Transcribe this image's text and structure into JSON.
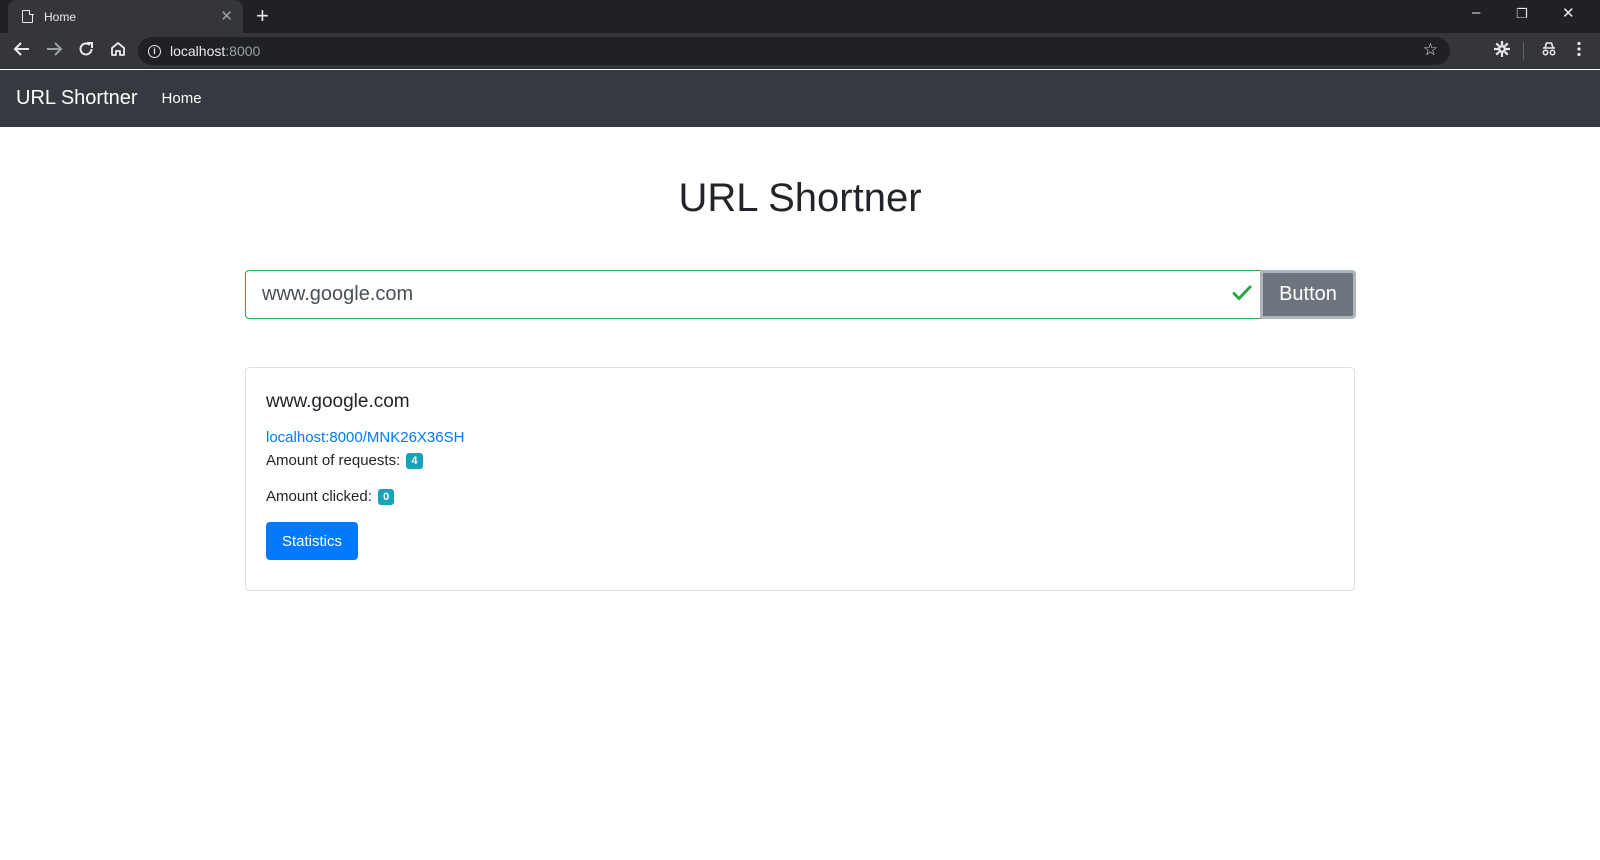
{
  "browser": {
    "tab_title": "Home",
    "tab_close": "✕",
    "new_tab": "+",
    "url_host": "localhost",
    "url_port": ":8000",
    "controls": {
      "minimize": "–",
      "restore": "❐",
      "close": "✕"
    }
  },
  "navbar": {
    "brand": "URL Shortner",
    "links": [
      {
        "label": "Home"
      }
    ]
  },
  "main": {
    "title": "URL Shortner",
    "input_value": "www.google.com",
    "button_label": "Button"
  },
  "result": {
    "original_url": "www.google.com",
    "short_url": "localhost:8000/MNK26X36SH",
    "requests_label": "Amount of requests:",
    "requests_count": "4",
    "clicked_label": "Amount clicked:",
    "clicked_count": "0",
    "stats_button": "Statistics"
  },
  "colors": {
    "navbar": "#343a40",
    "link": "#007bff",
    "valid": "#28a745",
    "badge": "#17a2b8",
    "secondary_button": "#6c757d"
  }
}
